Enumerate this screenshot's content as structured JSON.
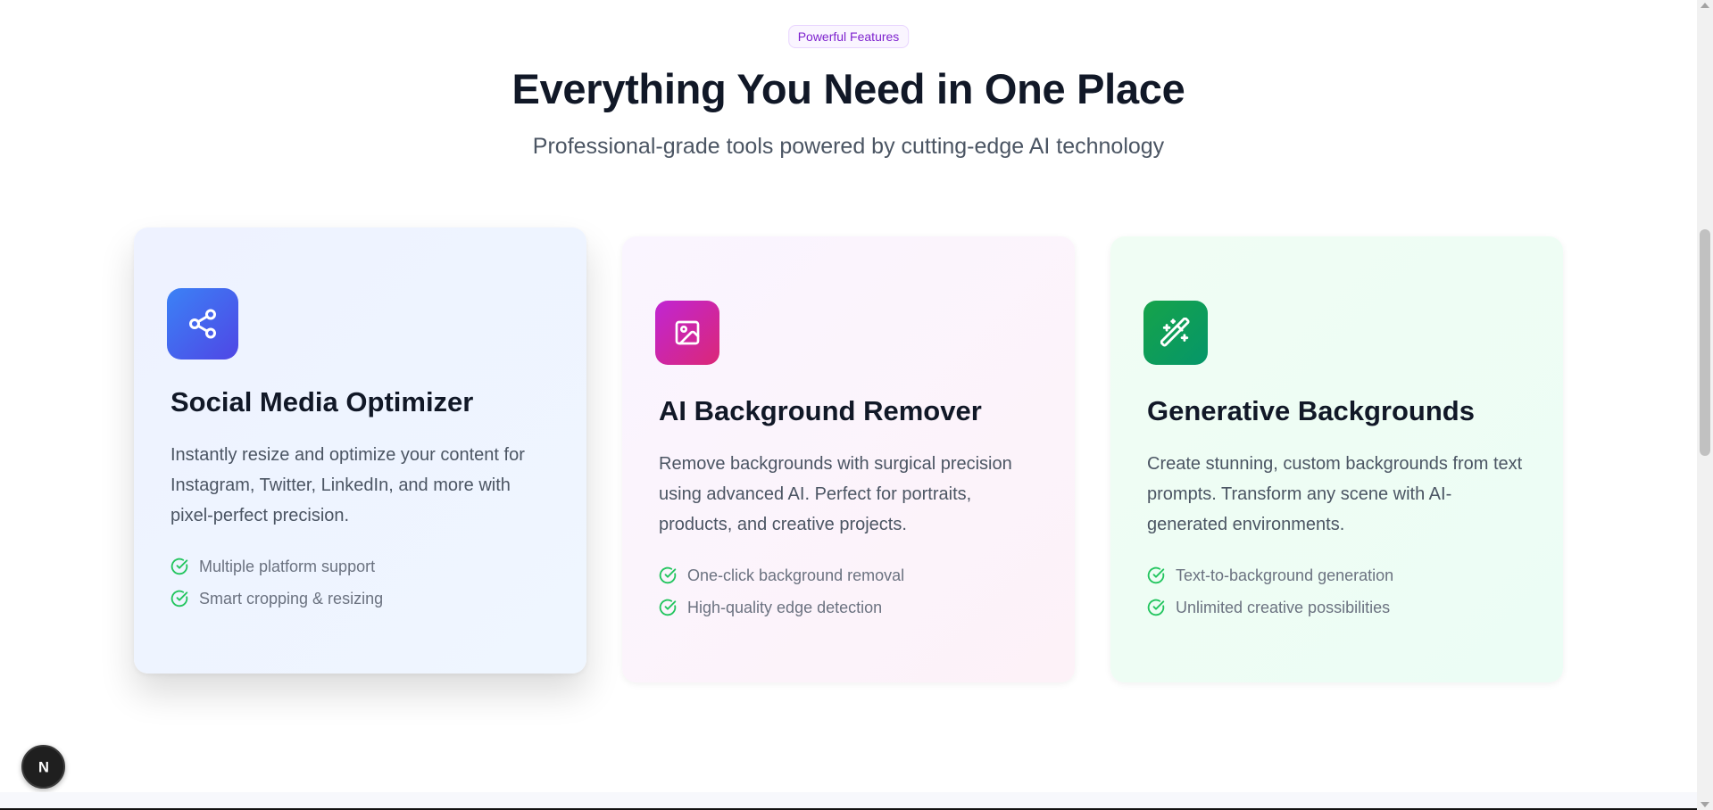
{
  "header": {
    "badge": "Powerful Features",
    "title": "Everything You Need in One Place",
    "subtitle": "Professional-grade tools powered by cutting-edge AI technology"
  },
  "cards": [
    {
      "icon": "share-icon",
      "title": "Social Media Optimizer",
      "description": "Instantly resize and optimize your content for Instagram, Twitter, LinkedIn, and more with pixel-perfect precision.",
      "features": [
        "Multiple platform support",
        "Smart cropping & resizing"
      ]
    },
    {
      "icon": "image-icon",
      "title": "AI Background Remover",
      "description": "Remove backgrounds with surgical precision using advanced AI. Perfect for portraits, products, and creative projects.",
      "features": [
        "One-click background removal",
        "High-quality edge detection"
      ]
    },
    {
      "icon": "magic-wand-icon",
      "title": "Generative Backgrounds",
      "description": "Create stunning, custom backgrounds from text prompts. Transform any scene with AI-generated environments.",
      "features": [
        "Text-to-background generation",
        "Unlimited creative possibilities"
      ]
    }
  ],
  "dev_indicator": {
    "label": "N"
  },
  "colors": {
    "badge_text": "#7e22ce",
    "check": "#22c55e",
    "card1_icon": "#4f46e5",
    "card2_icon": "#db2777",
    "card3_icon": "#16a34a"
  }
}
